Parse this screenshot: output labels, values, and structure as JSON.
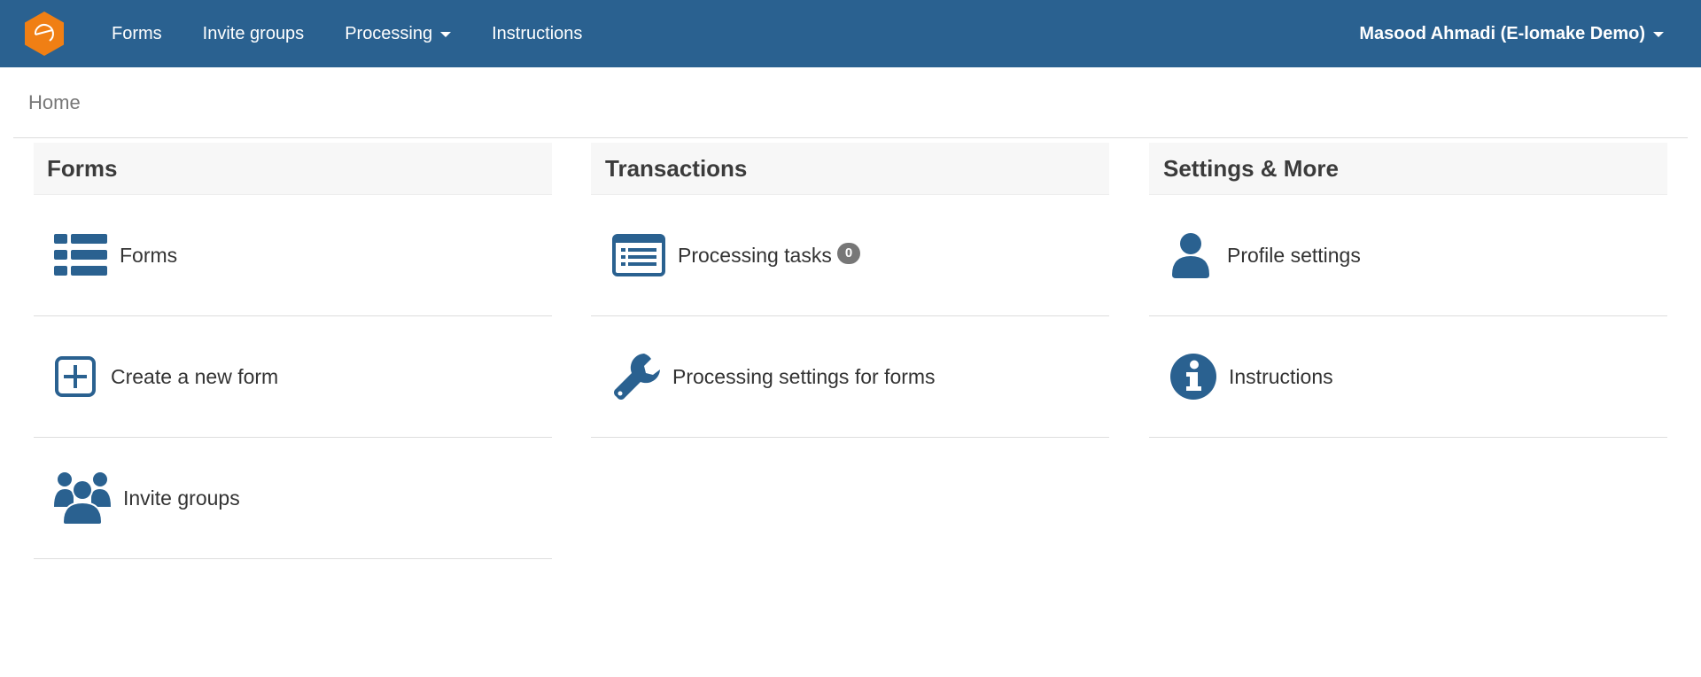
{
  "navbar": {
    "logo_icon": "app-logo-icon",
    "links": [
      {
        "label": "Forms"
      },
      {
        "label": "Invite groups"
      },
      {
        "label": "Processing"
      },
      {
        "label": "Instructions"
      }
    ],
    "user": "Masood Ahmadi (E-lomake Demo)"
  },
  "breadcrumb": {
    "home": "Home"
  },
  "panels": {
    "forms": {
      "title": "Forms",
      "items": [
        {
          "label": "Forms",
          "icon": "list-icon"
        },
        {
          "label": "Create a new form",
          "icon": "plus-square-icon"
        },
        {
          "label": "Invite groups",
          "icon": "users-icon"
        }
      ]
    },
    "transactions": {
      "title": "Transactions",
      "items": [
        {
          "label": "Processing tasks",
          "badge": "0",
          "icon": "list-alt-icon"
        },
        {
          "label": "Processing settings for forms",
          "icon": "wrench-icon"
        }
      ]
    },
    "settings": {
      "title": "Settings & More",
      "items": [
        {
          "label": "Profile settings",
          "icon": "user-icon"
        },
        {
          "label": "Instructions",
          "icon": "info-circle-icon"
        }
      ]
    }
  },
  "colors": {
    "navbar_bg": "#2a6190",
    "icon_blue": "#2a6190",
    "logo_orange": "#f07f14",
    "badge_bg": "#777777",
    "heading_bg": "#f7f7f7"
  }
}
